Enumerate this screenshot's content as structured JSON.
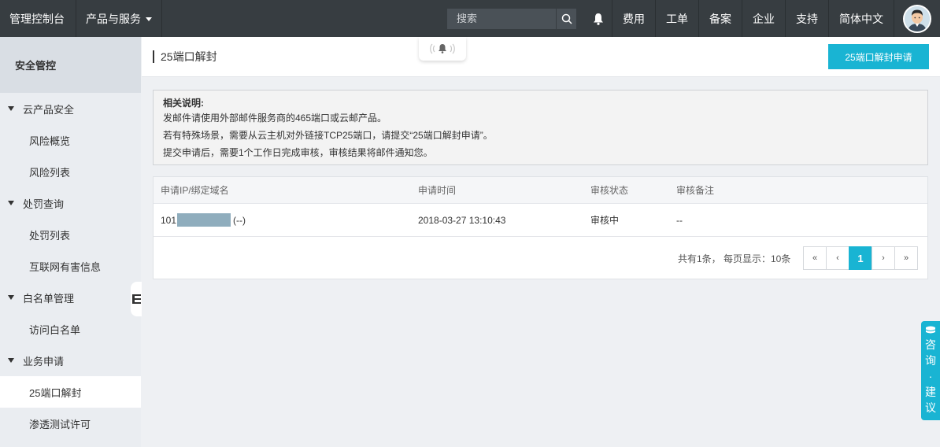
{
  "topbar": {
    "brand": "管理控制台",
    "products": "产品与服务",
    "search_placeholder": "搜索",
    "links": [
      "费用",
      "工单",
      "备案",
      "企业",
      "支持",
      "简体中文"
    ]
  },
  "sidebar": {
    "title": "安全管控",
    "groups": [
      {
        "label": "云产品安全",
        "items": [
          "风险概览",
          "风险列表"
        ]
      },
      {
        "label": "处罚查询",
        "items": [
          "处罚列表",
          "互联网有害信息"
        ]
      },
      {
        "label": "白名单管理",
        "items": [
          "访问白名单"
        ]
      },
      {
        "label": "业务申请",
        "items": [
          "25端口解封",
          "渗透测试许可"
        ]
      }
    ]
  },
  "main": {
    "title": "25端口解封",
    "apply_button": "25端口解封申请",
    "notice": {
      "title": "相关说明:",
      "lines": [
        "发邮件请使用外部邮件服务商的465端口或云邮产品。",
        "若有特殊场景，需要从云主机对外链接TCP25端口，请提交“25端口解封申请”。",
        "提交申请后，需要1个工作日完成审核，审核结果将邮件通知您。"
      ]
    },
    "table": {
      "columns": [
        "申请IP/绑定域名",
        "申请时间",
        "审核状态",
        "审核备注"
      ],
      "rows": [
        {
          "ip_prefix": "101",
          "ip_suffix": "(--)",
          "time": "2018-03-27 13:10:43",
          "status": "审核中",
          "remark": "--"
        }
      ]
    },
    "pagination": {
      "info": "共有1条， 每页显示：10条",
      "first": "«",
      "prev": "‹",
      "current": "1",
      "next": "›",
      "last": "»"
    }
  },
  "float_help": [
    "咨",
    "询",
    "·",
    "建",
    "议"
  ],
  "colors": {
    "accent": "#19b4d3",
    "topbar": "#373d41"
  }
}
